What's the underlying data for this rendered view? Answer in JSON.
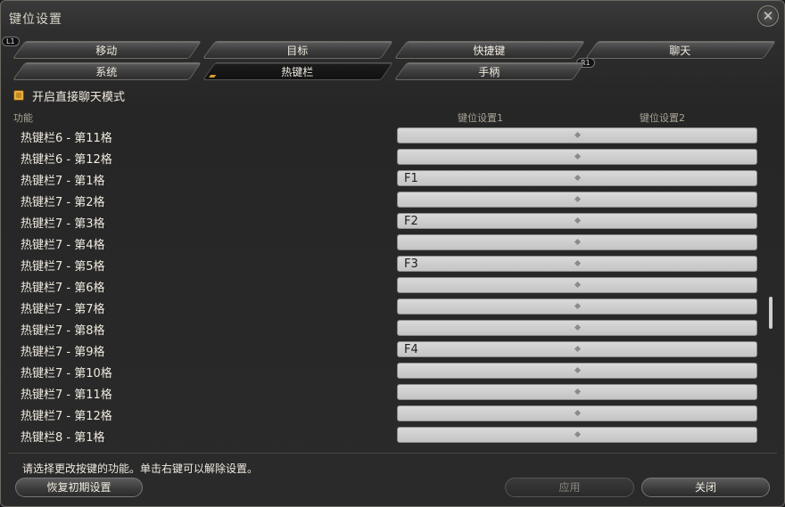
{
  "window": {
    "title": "键位设置",
    "close_icon": "close-x-icon"
  },
  "badges": {
    "left": "L1",
    "right": "R1"
  },
  "tabs_row1": [
    "移动",
    "目标",
    "快捷键",
    "聊天"
  ],
  "tabs_row2": [
    "系统",
    "热键栏",
    "手柄"
  ],
  "active_tab": "热键栏",
  "checkbox": {
    "label": "开启直接聊天模式",
    "checked": true
  },
  "columns": {
    "function": "功能",
    "key1": "键位设置1",
    "key2": "键位设置2"
  },
  "rows": [
    {
      "label": "热键栏6 - 第11格",
      "key1": ""
    },
    {
      "label": "热键栏6 - 第12格",
      "key1": ""
    },
    {
      "label": "热键栏7 - 第1格",
      "key1": "F1"
    },
    {
      "label": "热键栏7 - 第2格",
      "key1": ""
    },
    {
      "label": "热键栏7 - 第3格",
      "key1": "F2"
    },
    {
      "label": "热键栏7 - 第4格",
      "key1": ""
    },
    {
      "label": "热键栏7 - 第5格",
      "key1": "F3"
    },
    {
      "label": "热键栏7 - 第6格",
      "key1": ""
    },
    {
      "label": "热键栏7 - 第7格",
      "key1": ""
    },
    {
      "label": "热键栏7 - 第8格",
      "key1": ""
    },
    {
      "label": "热键栏7 - 第9格",
      "key1": "F4"
    },
    {
      "label": "热键栏7 - 第10格",
      "key1": ""
    },
    {
      "label": "热键栏7 - 第11格",
      "key1": ""
    },
    {
      "label": "热键栏7 - 第12格",
      "key1": ""
    },
    {
      "label": "热键栏8 - 第1格",
      "key1": ""
    }
  ],
  "hint": "请选择更改按键的功能。单击右键可以解除设置。",
  "buttons": {
    "reset": "恢复初期设置",
    "apply": "应用",
    "close": "关闭"
  },
  "colors": {
    "accent": "#c58a1f",
    "slot": "#cfcfcf",
    "panel": "#2a2a2a"
  }
}
